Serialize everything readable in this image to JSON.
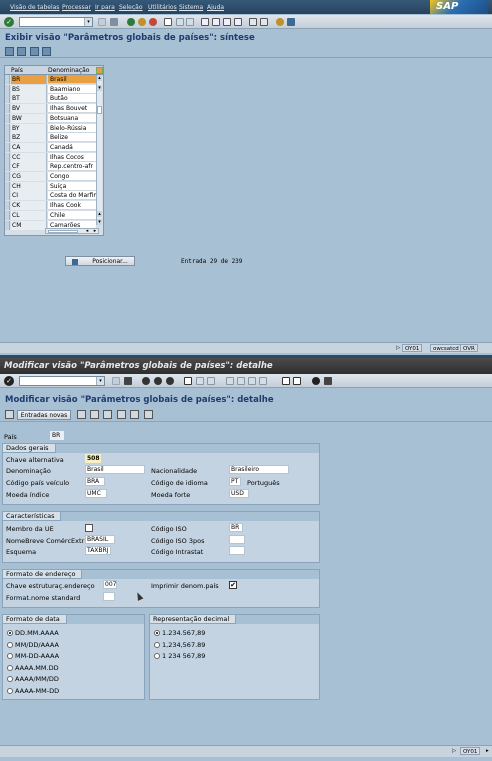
{
  "menu": [
    "Visão de tabelas",
    "Processar",
    "Ir para",
    "Seleção",
    "Utilitários",
    "Sistema",
    "Ajuda"
  ],
  "sap_logo": "SAP",
  "window1": {
    "title": "Exibir visão \"Parâmetros globais de países\": síntese",
    "table": {
      "headers": [
        "País",
        "Denominação"
      ],
      "rows": [
        [
          "BR",
          "Brasil"
        ],
        [
          "BS",
          "Baamiano"
        ],
        [
          "BT",
          "Butão"
        ],
        [
          "BV",
          "Ilhas Bouvet"
        ],
        [
          "BW",
          "Botsuana"
        ],
        [
          "BY",
          "Bielo-Rússia"
        ],
        [
          "BZ",
          "Belize"
        ],
        [
          "CA",
          "Canadá"
        ],
        [
          "CC",
          "Ilhas Cocos"
        ],
        [
          "CF",
          "Rep.centro-afr"
        ],
        [
          "CG",
          "Congo"
        ],
        [
          "CH",
          "Suíça"
        ],
        [
          "CI",
          "Costa do Marfim"
        ],
        [
          "CK",
          "Ilhas Cook"
        ],
        [
          "CL",
          "Chile"
        ],
        [
          "CM",
          "Camarões"
        ]
      ],
      "selected_index": 0
    },
    "position_button": "Posicionar...",
    "entry_info": "Entrada 29 de 239",
    "status": {
      "system": "OY01",
      "host": "owcsatcd",
      "mode": "OVR"
    }
  },
  "window2": {
    "titlebar": "Modificar visão \"Parâmetros globais de países\": detalhe",
    "title": "Modificar visão \"Parâmetros globais de países\": detalhe",
    "new_entries_button": "Entradas novas",
    "country_label": "País",
    "country_value": "BR",
    "dados_gerais": {
      "title": "Dados gerais",
      "chave_alt_label": "Chave alternativa",
      "chave_alt_value": "508",
      "denominacao_label": "Denominação",
      "denominacao_value": "Brasil",
      "nacionalidade_label": "Nacionalidade",
      "nacionalidade_value": "Brasileiro",
      "codigo_veiculo_label": "Código país veículo",
      "codigo_veiculo_value": "BRA",
      "codigo_idioma_label": "Código de idioma",
      "codigo_idioma_value": "PT",
      "idioma_text": "Português",
      "moeda_indice_label": "Moeda índice",
      "moeda_indice_value": "UMC",
      "moeda_forte_label": "Moeda forte",
      "moeda_forte_value": "USD"
    },
    "caracteristicas": {
      "title": "Características",
      "membro_ue_label": "Membro da UE",
      "codigo_iso_label": "Código ISO",
      "codigo_iso_value": "BR",
      "nomebreve_label": "NomeBreve ComércExtr",
      "nomebreve_value": "BRASIL",
      "codigo_iso3_label": "Código ISO 3pos",
      "codigo_iso3_value": "",
      "esquema_label": "Esquema",
      "esquema_value": "TAXBRJ",
      "codigo_intrastat_label": "Código Intrastat",
      "codigo_intrastat_value": ""
    },
    "formato_endereco": {
      "title": "Formato de endereço",
      "chave_label": "Chave estruturaç.endereço",
      "chave_value": "007",
      "imprimir_label": "Imprimir denom.país",
      "imprimir_checked": "✔",
      "format_label": "Format.nome standard",
      "format_value": ""
    },
    "formato_data": {
      "title": "Formato de data",
      "options": [
        "DD.MM.AAAA",
        "MM/DD/AAAA",
        "MM-DD-AAAA",
        "AAAA.MM.DD",
        "AAAA/MM/DD",
        "AAAA-MM-DD"
      ],
      "selected": 0
    },
    "representacao_decimal": {
      "title": "Representação decimal",
      "options": [
        "1.234.567,89",
        "1,234,567.89",
        "1 234 567,89"
      ],
      "selected": 0
    },
    "status": {
      "system": "OY01"
    }
  }
}
